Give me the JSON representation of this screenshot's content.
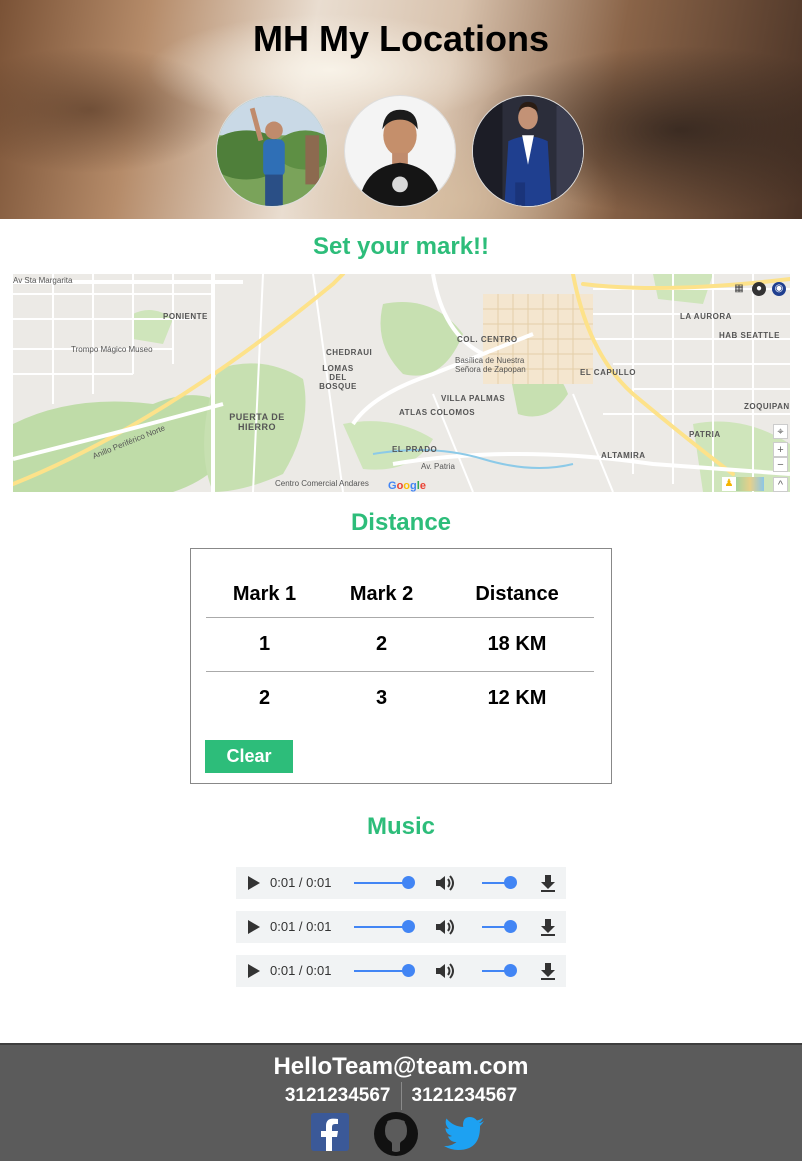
{
  "header": {
    "title": "MH My Locations",
    "avatars": [
      {
        "name": "team-member-1"
      },
      {
        "name": "team-member-2"
      },
      {
        "name": "team-member-3"
      }
    ]
  },
  "map_section": {
    "title": "Set your mark!!",
    "labels": {
      "poniente": "PONIENTE",
      "trompo": "Trompo Mágico Museo",
      "chedraui": "CHEDRAUI",
      "lomas": "LOMAS DEL BOSQUE",
      "puerta": "PUERTA DE HIERRO",
      "atlas": "ATLAS COLOMOS",
      "villa": "VILLA PALMAS",
      "col_centro": "COL. CENTRO",
      "basilica": "Basílica de Nuestra Señora de Zapopan",
      "capullo": "EL CAPULLO",
      "aurora": "LA AURORA",
      "seattle": "HAB SEATTLE",
      "zoquipan": "ZOQUIPAN",
      "patria": "PATRIA",
      "altamira": "ALTAMIRA",
      "prado": "EL PRADO",
      "centro_comercial": "Centro Comercial Andares",
      "periferico": "Anillo Periférico Norte",
      "av_sta_margarita": "Av Sta Margarita",
      "av_patria": "Av. Patria"
    },
    "google": "Google",
    "controls": {
      "locate": "⌖",
      "zoom_in": "+",
      "zoom_out": "−",
      "expand": "^"
    }
  },
  "distance_section": {
    "title": "Distance",
    "columns": [
      "Mark 1",
      "Mark 2",
      "Distance"
    ],
    "rows": [
      [
        "1",
        "2",
        "18 KM"
      ],
      [
        "2",
        "3",
        "12 KM"
      ]
    ],
    "clear_label": "Clear"
  },
  "music_section": {
    "title": "Music",
    "players": [
      {
        "time": "0:01 / 0:01"
      },
      {
        "time": "0:01 / 0:01"
      },
      {
        "time": "0:01 / 0:01"
      }
    ]
  },
  "footer": {
    "email": "HelloTeam@team.com",
    "phones": [
      "3121234567",
      "3121234567"
    ],
    "social": [
      "facebook-icon",
      "github-icon",
      "twitter-icon"
    ]
  },
  "colors": {
    "accent": "#2dbd7a",
    "footer_bg": "#5b5b5b",
    "player_blue": "#4285f4",
    "facebook": "#3b5998",
    "twitter": "#1da1f2"
  }
}
